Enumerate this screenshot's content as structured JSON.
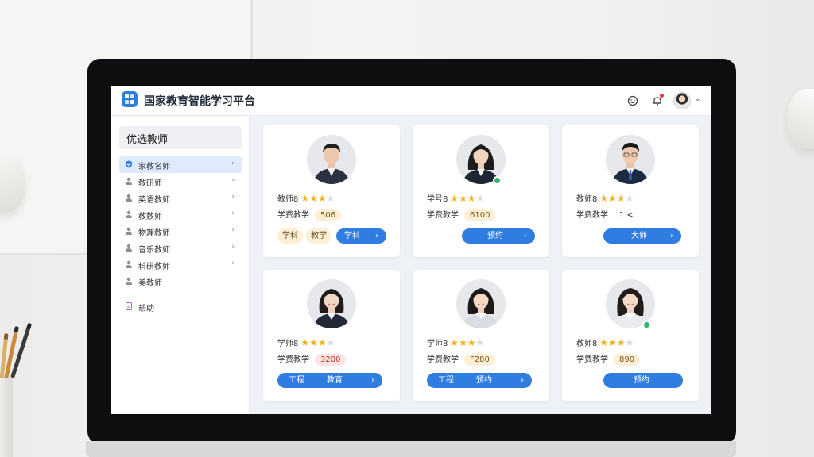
{
  "app": {
    "title": "国家教育智能学习平台"
  },
  "colors": {
    "accent": "#2f7de1",
    "star": "#f3b21b",
    "verified": "#34b26a"
  },
  "topbar": {
    "icons": [
      "smiley-icon",
      "bell-icon",
      "user-avatar",
      "chevron-down-icon"
    ],
    "caret": "⌄"
  },
  "sidebar": {
    "header": "优选教师",
    "items": [
      {
        "label": "家教名师",
        "icon": "verified-user-icon",
        "chevron": "›",
        "active": true
      },
      {
        "label": "教研师",
        "icon": "person-icon",
        "chevron": "›"
      },
      {
        "label": "英语教师",
        "icon": "person-icon",
        "chevron": "›"
      },
      {
        "label": "教数师",
        "icon": "person-icon",
        "chevron": "›"
      },
      {
        "label": "物理教师",
        "icon": "person-icon",
        "chevron": "›"
      },
      {
        "label": "音乐教师",
        "icon": "person-icon",
        "chevron": "›"
      },
      {
        "label": "科研教师",
        "icon": "person-icon",
        "chevron": "›"
      },
      {
        "label": "美教师",
        "icon": "person-icon",
        "chevron": "›"
      }
    ],
    "footer": {
      "label": "帮助",
      "icon": "document-icon"
    }
  },
  "cards": [
    {
      "rating_label": "教师8",
      "rating": 3,
      "max_rating": 4,
      "price_label": "学费教学",
      "price": "506",
      "price_style": "amber",
      "tags": [
        "学科",
        "教学"
      ],
      "button_label": "学科",
      "button_chevron": "›",
      "verified": false,
      "person": "male-1"
    },
    {
      "rating_label": "学号8",
      "rating": 3,
      "max_rating": 4,
      "price_label": "学费教学",
      "price": "6100",
      "price_style": "amber",
      "tags": [],
      "button_label": "预约",
      "button_chevron": "›",
      "verified": true,
      "person": "female-1"
    },
    {
      "rating_label": "教师8",
      "rating": 3,
      "max_rating": 4,
      "price_label": "学费教学",
      "price": "1 <",
      "price_style": "none",
      "tags": [],
      "button_label": "大师",
      "button_chevron": "›",
      "verified": false,
      "person": "male-2"
    },
    {
      "rating_label": "学师8",
      "rating": 3,
      "max_rating": 4,
      "price_label": "学费教学",
      "price": "3200",
      "price_style": "red",
      "tags": [],
      "button_left": "工程",
      "button_label": "教育",
      "button_chevron": "›",
      "verified": false,
      "person": "female-2"
    },
    {
      "rating_label": "学师8",
      "rating": 3,
      "max_rating": 4,
      "price_label": "学费教学",
      "price": "F280",
      "price_style": "amber",
      "tags": [],
      "button_left": "工程",
      "button_label": "预约",
      "button_chevron": "›",
      "verified": false,
      "person": "female-3"
    },
    {
      "rating_label": "教师8",
      "rating": 3,
      "max_rating": 4,
      "price_label": "学费教学",
      "price": "890",
      "price_style": "amber",
      "tags": [],
      "button_label": "预约",
      "button_chevron": "",
      "verified": true,
      "person": "female-4"
    }
  ]
}
